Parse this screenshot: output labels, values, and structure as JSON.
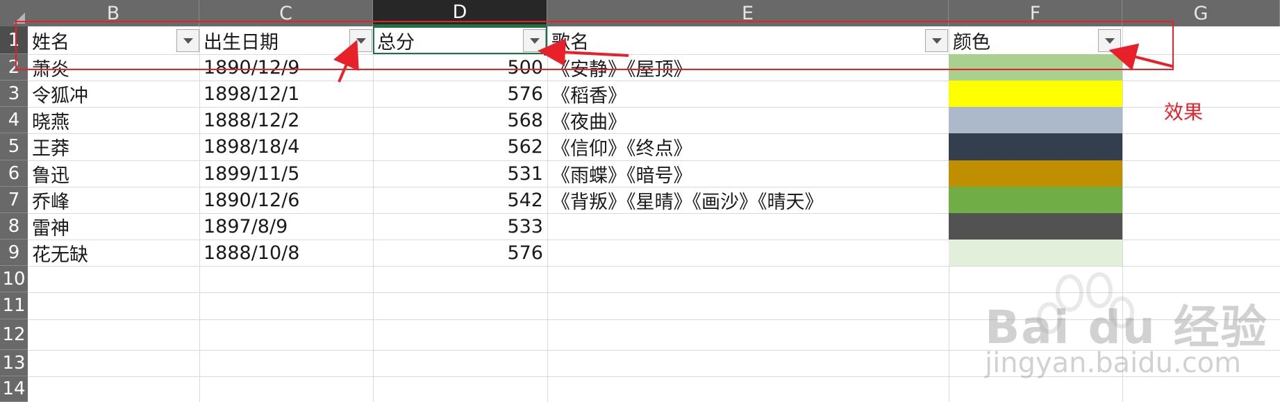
{
  "columns": [
    "B",
    "C",
    "D",
    "E",
    "F",
    "G"
  ],
  "row_numbers": [
    "1",
    "2",
    "3",
    "4",
    "5",
    "6",
    "7",
    "8",
    "9",
    "10",
    "11",
    "12",
    "13",
    "14"
  ],
  "headers": {
    "name": "姓名",
    "birth": "出生日期",
    "score": "总分",
    "songs": "歌名",
    "color": "颜色"
  },
  "rows": [
    {
      "name": "萧炎",
      "birth": "1890/12/9",
      "score": "500",
      "songs": "《安静》《屋顶》"
    },
    {
      "name": "令狐冲",
      "birth": "1898/12/1",
      "score": "576",
      "songs": "《稻香》"
    },
    {
      "name": "晓燕",
      "birth": "1888/12/2",
      "score": "568",
      "songs": "《夜曲》"
    },
    {
      "name": "王莽",
      "birth": "1898/18/4",
      "score": "562",
      "songs": "《信仰》《终点》"
    },
    {
      "name": "鲁迅",
      "birth": "1899/11/5",
      "score": "531",
      "songs": "《雨蝶》《暗号》"
    },
    {
      "name": "乔峰",
      "birth": "1890/12/6",
      "score": "542",
      "songs": "《背叛》《星晴》《画沙》《晴天》"
    },
    {
      "name": "雷神",
      "birth": "1897/8/9",
      "score": "533",
      "songs": ""
    },
    {
      "name": "花无缺",
      "birth": "1888/10/8",
      "score": "576",
      "songs": ""
    }
  ],
  "color_swatches": [
    "#a9d08e",
    "#ffff00",
    "#acb9ca",
    "#333f4f",
    "#bf8f00",
    "#70ad47",
    "#525252",
    "#e2efda"
  ],
  "annotation": {
    "label": "效果",
    "color": "#e8202a"
  },
  "watermark": {
    "logo_text": "Bai du 经验",
    "url_text": "jingyan.baidu.com"
  },
  "theme": {
    "header_bg": "#696969",
    "selection_green": "#1e7145",
    "gridline": "#d9d9d9"
  }
}
